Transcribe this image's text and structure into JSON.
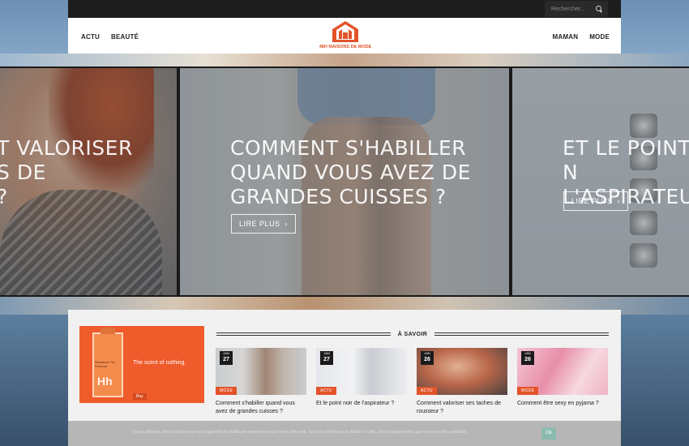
{
  "topbar": {
    "search_placeholder": "Rechercher..."
  },
  "header": {
    "nav_left": [
      "ACTU",
      "BEAUTÉ"
    ],
    "nav_right": [
      "MAMAN",
      "MODE"
    ],
    "logo_text": "48H MAISONS DE MODE"
  },
  "slider": {
    "left": {
      "title_line1": "T VALORISER",
      "title_line2": "S DE",
      "title_line3": "?"
    },
    "center": {
      "title_line1": "COMMENT S'HABILLER",
      "title_line2": "QUAND VOUS AVEZ DE",
      "title_line3": "GRANDES CUISSES ?",
      "button": "LIRE PLUS"
    },
    "right": {
      "title_line1": "ET LE POINT N",
      "title_line2": "L'ASPIRATEUR",
      "button": "LIRE PLUS"
    }
  },
  "ad": {
    "brand": "Maradora The Perfume",
    "hh": "Hh",
    "tagline": "The scent of nothing.",
    "cta": "Buy"
  },
  "section": {
    "title": "À SAVOIR"
  },
  "cards": [
    {
      "month": "JAN",
      "day": "27",
      "category": "MODE",
      "title": "Comment s'habiller quand vous avez de grandes cuisses ?"
    },
    {
      "month": "JAN",
      "day": "27",
      "category": "ACTU",
      "title": "Et le point noir de l'aspirateur ?"
    },
    {
      "month": "JAN",
      "day": "26",
      "category": "ACTU",
      "title": "Comment valoriser ses taches de rousseur ?"
    },
    {
      "month": "JAN",
      "day": "26",
      "category": "MODE",
      "title": "Comment être sexy en pyjama ?"
    }
  ],
  "cookie": {
    "text": "Nous utilisons des cookies pour vous garantir la meilleure expérience sur notre site web. Si vous continuez à utiliser ce site, nous supposerons que vous en êtes satisfait.",
    "ok": "Ok"
  },
  "colors": {
    "accent": "#e2542a",
    "topbar": "#1d1d1d"
  }
}
